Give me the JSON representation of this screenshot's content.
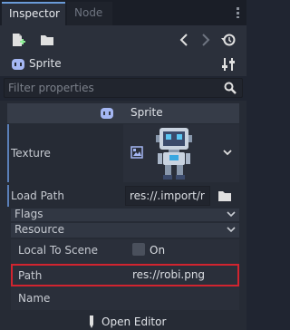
{
  "tabs": [
    {
      "label": "Inspector",
      "active": true
    },
    {
      "label": "Node",
      "active": false
    }
  ],
  "toolbar": {
    "icons": [
      "new-resource-icon",
      "load-resource-icon",
      "history-back-icon",
      "history-forward-icon",
      "history-icon"
    ]
  },
  "object": {
    "name": "Sprite",
    "icon": "sprite-icon",
    "tools_icon": "tools-icon"
  },
  "filter": {
    "placeholder": "Filter properties",
    "value": ""
  },
  "section": {
    "title": "Sprite"
  },
  "properties": {
    "texture_label": "Texture",
    "load_path_label": "Load Path",
    "load_path_value": "res://.import/r",
    "flags_label": "Flags",
    "resource_label": "Resource",
    "local_to_scene_label": "Local To Scene",
    "local_to_scene_value": "On",
    "path_label": "Path",
    "path_value": "res://robi.png",
    "name_label": "Name",
    "name_value": ""
  },
  "footer": {
    "open_editor_label": "Open Editor"
  },
  "colors": {
    "accent": "#6a9bd8",
    "highlight": "#d1242f",
    "background": "#202531",
    "panel": "#262b35"
  }
}
